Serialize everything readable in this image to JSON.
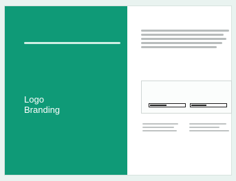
{
  "left_panel": {
    "tiny_text_1": "",
    "tiny_text_2": "",
    "brand_line_1": "Logo",
    "brand_line_2": "Branding",
    "bottom_link": ""
  },
  "right_panel": {
    "title": "",
    "columns": {
      "left_heading": "",
      "right_heading": ""
    },
    "panel": {
      "left_subtitle": "",
      "left_hint": "",
      "right_subtitle": "",
      "right_hint": "",
      "left_bar_fill": 0.48,
      "right_bar_fill": 0.44
    }
  },
  "colors": {
    "left_bg": "#0f9a77",
    "card_bg": "#ffffff",
    "page_bg": "#e9f3f0"
  }
}
